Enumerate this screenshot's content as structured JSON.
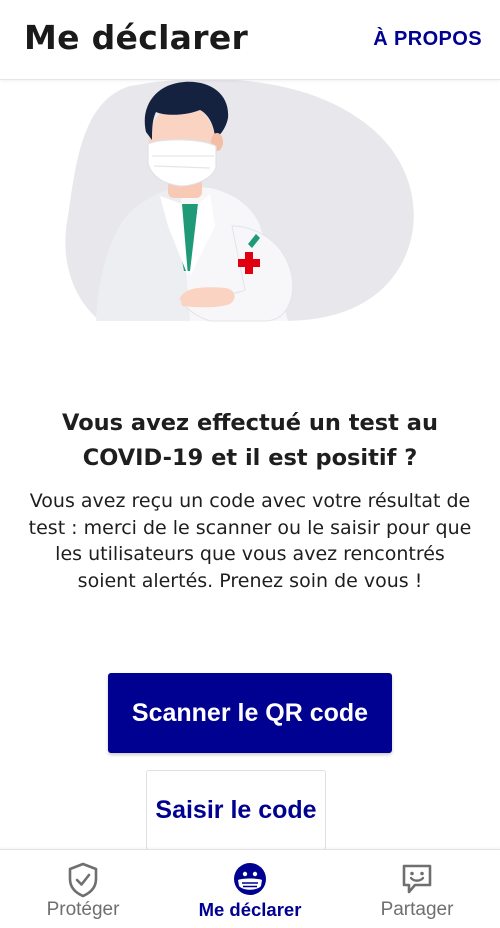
{
  "header": {
    "title": "Me déclarer",
    "about_label": "À PROPOS"
  },
  "illustration": {
    "icon": "doctor-with-mask-illustration"
  },
  "main": {
    "heading": "Vous avez effectué un test au COVID-19 et il est positif ?",
    "body": "Vous avez reçu un code avec votre résultat de test : merci de le scanner ou le saisir pour que les utilisateurs que vous avez rencontrés soient alertés. Prenez soin de vous !",
    "scan_button": "Scanner le QR code",
    "enter_code_button": "Saisir le code"
  },
  "bottom_nav": {
    "items": [
      {
        "label": "Protéger",
        "icon": "shield-check-icon",
        "active": false
      },
      {
        "label": "Me déclarer",
        "icon": "masked-face-icon",
        "active": true
      },
      {
        "label": "Partager",
        "icon": "chat-smile-icon",
        "active": false
      }
    ]
  },
  "colors": {
    "accent": "#000091",
    "text": "#1e1e1e",
    "inactive_nav": "#6f6f6f"
  }
}
